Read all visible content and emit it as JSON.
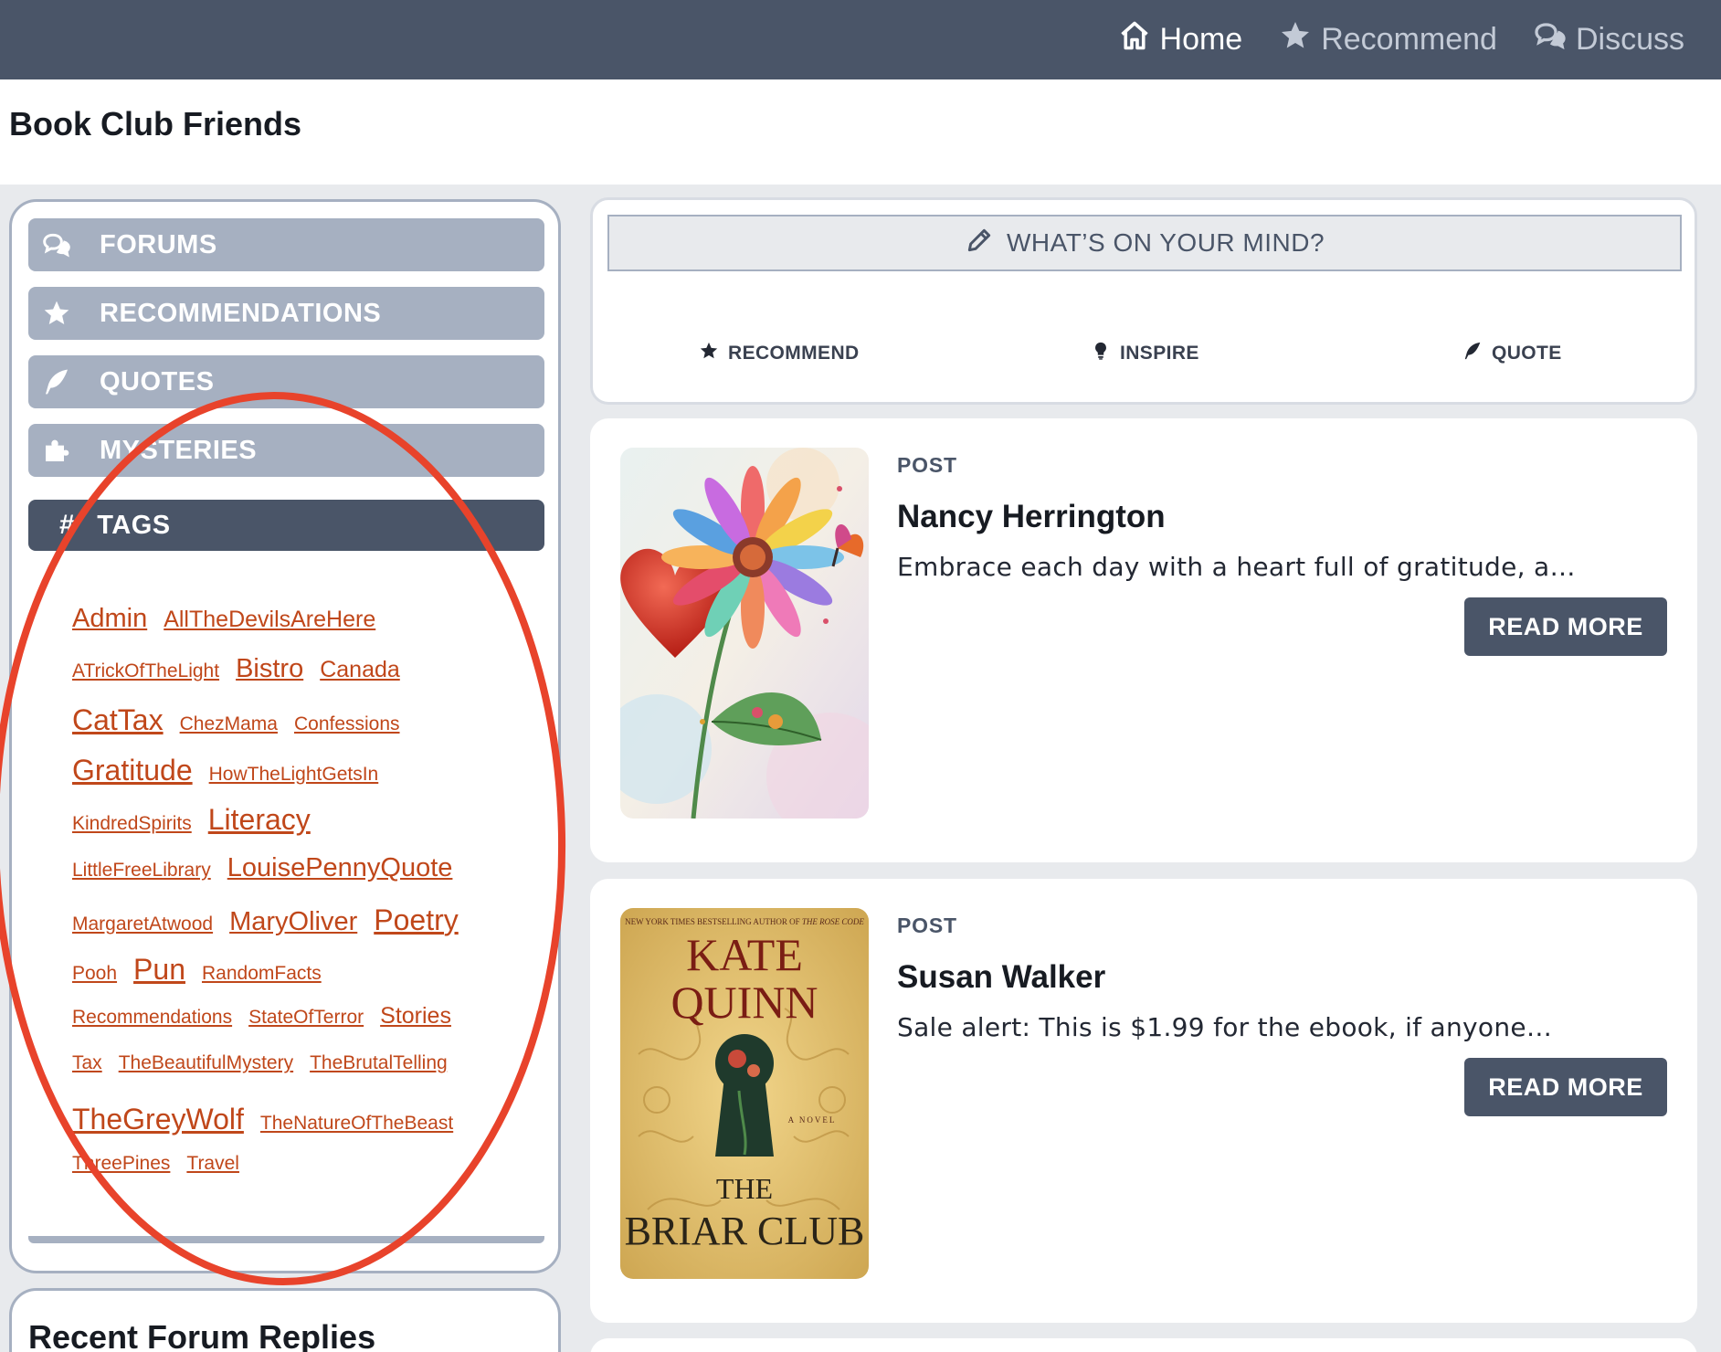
{
  "topnav": [
    {
      "label": "Home",
      "icon": "home-icon",
      "active": true
    },
    {
      "label": "Recommend",
      "icon": "star-icon",
      "active": false
    },
    {
      "label": "Discuss",
      "icon": "chat-icon",
      "active": false
    }
  ],
  "site": {
    "title": "Book Club Friends"
  },
  "sidebar": {
    "buttons": [
      {
        "label": "FORUMS",
        "icon": "chat-icon"
      },
      {
        "label": "RECOMMENDATIONS",
        "icon": "star-icon"
      },
      {
        "label": "QUOTES",
        "icon": "feather-icon"
      },
      {
        "label": "MYSTERIES",
        "icon": "puzzle-icon"
      }
    ],
    "tags_header": "TAGS",
    "tags_lines": [
      [
        {
          "t": "Admin",
          "s": 3
        },
        {
          "t": "AllTheDevilsAreHere",
          "s": 2
        }
      ],
      [
        {
          "t": "ATrickOfTheLight",
          "s": 1
        },
        {
          "t": "Bistro",
          "s": 3
        },
        {
          "t": "Canada",
          "s": 2
        }
      ],
      [
        {
          "t": "CatTax",
          "s": 4
        },
        {
          "t": "ChezMama",
          "s": 1
        },
        {
          "t": "Confessions",
          "s": 1
        }
      ],
      [
        {
          "t": "Gratitude",
          "s": 4
        },
        {
          "t": "HowTheLightGetsIn",
          "s": 1
        }
      ],
      [
        {
          "t": "KindredSpirits",
          "s": 1
        },
        {
          "t": "Literacy",
          "s": 4
        }
      ],
      [
        {
          "t": "LittleFreeLibrary",
          "s": 1
        },
        {
          "t": "LouisePennyQuote",
          "s": 3
        }
      ],
      [
        {
          "t": "MargaretAtwood",
          "s": 1
        },
        {
          "t": "MaryOliver",
          "s": 3
        },
        {
          "t": "Poetry",
          "s": 4
        }
      ],
      [
        {
          "t": "Pooh",
          "s": 1
        },
        {
          "t": "Pun",
          "s": 4
        },
        {
          "t": "RandomFacts",
          "s": 1
        }
      ],
      [
        {
          "t": "Recommendations",
          "s": 1
        },
        {
          "t": "StateOfTerror",
          "s": 1
        },
        {
          "t": "Stories",
          "s": 2
        }
      ],
      [
        {
          "t": "Tax",
          "s": 1
        },
        {
          "t": "TheBeautifulMystery",
          "s": 1
        },
        {
          "t": "TheBrutalTelling",
          "s": 1
        }
      ],
      [
        {
          "t": "TheGreyWolf",
          "s": 4
        },
        {
          "t": "TheNatureOfTheBeast",
          "s": 1
        }
      ],
      [
        {
          "t": "ThreePines",
          "s": 1
        },
        {
          "t": "Travel",
          "s": 1
        }
      ]
    ]
  },
  "recent": {
    "title": "Recent Forum Replies"
  },
  "composer": {
    "prompt": "WHAT’S ON YOUR MIND?",
    "actions": [
      {
        "label": "RECOMMEND",
        "icon": "star-icon"
      },
      {
        "label": "INSPIRE",
        "icon": "lightbulb-icon"
      },
      {
        "label": "QUOTE",
        "icon": "feather-icon"
      }
    ]
  },
  "posts": [
    {
      "type": "POST",
      "author": "Nancy Herrington",
      "excerpt": "Embrace each day with a heart full of gratitude, a…",
      "button": "READ MORE",
      "image": "flower-heart-painting"
    },
    {
      "type": "POST",
      "author": "Susan Walker",
      "excerpt": "Sale alert: This is $1.99 for the ebook, if anyone…",
      "button": "READ MORE",
      "image": "book-cover-briar-club",
      "cover": {
        "top_line": "NEW YORK TIMES BESTSELLING AUTHOR OF",
        "top_italic": "THE ROSE CODE",
        "author": [
          "KATE",
          "QUINN"
        ],
        "novel": "A NOVEL",
        "title": [
          "THE",
          "BRIAR CLUB"
        ]
      }
    }
  ],
  "colors": {
    "nav_bg": "#4a5568",
    "sidebar_btn": "#a6b0c1",
    "tag_link": "#c0471a",
    "annotation": "#e8432b"
  }
}
